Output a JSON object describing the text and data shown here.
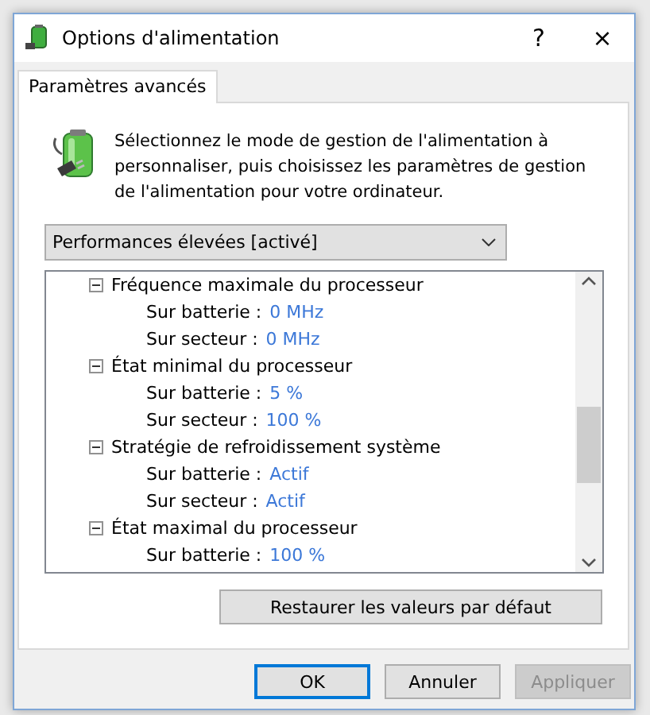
{
  "window": {
    "title": "Options d'alimentation",
    "help": "?",
    "close": "×"
  },
  "tabs": [
    {
      "label": "Paramètres avancés",
      "selected": true
    }
  ],
  "intro": "Sélectionnez le mode de gestion de l'alimentation à personnaliser, puis choisissez les paramètres de gestion de l'alimentation pour votre ordinateur.",
  "plan_select": {
    "value": "Performances élevées [activé]"
  },
  "settings": [
    {
      "label": "Fréquence maximale du processeur",
      "expanded": true,
      "children": [
        {
          "label": "Sur batterie :",
          "value": "0 MHz"
        },
        {
          "label": "Sur secteur :",
          "value": "0 MHz"
        }
      ]
    },
    {
      "label": "État minimal du processeur",
      "expanded": true,
      "children": [
        {
          "label": "Sur batterie :",
          "value": "5  %"
        },
        {
          "label": "Sur secteur :",
          "value": "100  %"
        }
      ]
    },
    {
      "label": "Stratégie de refroidissement système",
      "expanded": true,
      "children": [
        {
          "label": "Sur batterie :",
          "value": "Actif"
        },
        {
          "label": "Sur secteur :",
          "value": "Actif"
        }
      ]
    },
    {
      "label": "État maximal du processeur",
      "expanded": true,
      "children": [
        {
          "label": "Sur batterie :",
          "value": "100  %"
        }
      ]
    }
  ],
  "restore_button": "Restaurer les valeurs par défaut",
  "buttons": [
    {
      "label": "OK",
      "kind": "default",
      "disabled": false
    },
    {
      "label": "Annuler",
      "kind": "normal",
      "disabled": false
    },
    {
      "label": "Appliquer",
      "kind": "normal",
      "disabled": true
    }
  ]
}
